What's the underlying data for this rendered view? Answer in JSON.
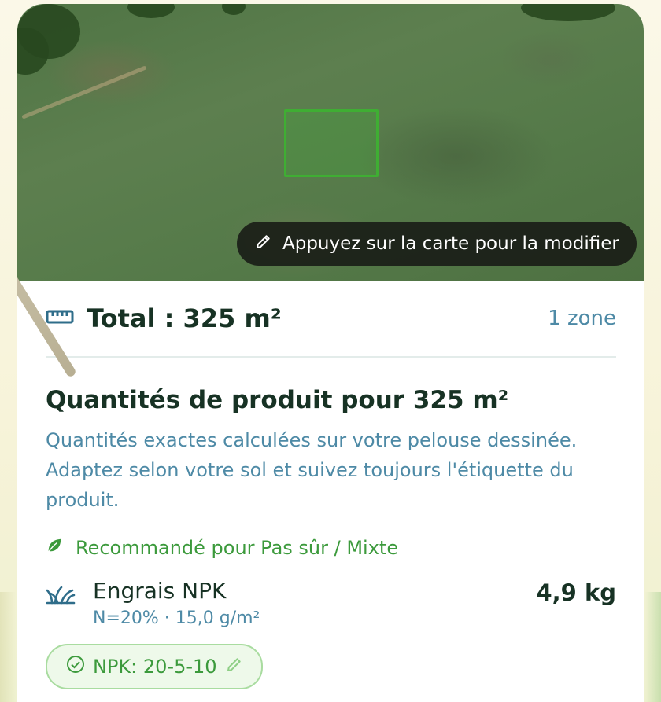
{
  "map": {
    "hint_label": "Appuyez sur la carte pour la modifier",
    "hint_icon": "pencil-icon"
  },
  "summary": {
    "total_label": "Total : 325 m²",
    "total_icon": "ruler-icon",
    "zone_count": "1 zone"
  },
  "quantities": {
    "title": "Quantités de produit pour 325 m²",
    "description": "Quantités exactes calculées sur votre pelouse dessinée. Adaptez selon votre sol et suivez toujours l'étiquette du produit.",
    "recommendation": "Recommandé pour Pas sûr / Mixte",
    "recommendation_icon": "leaf-icon"
  },
  "product": {
    "name": "Engrais NPK",
    "detail": "N=20% · 15,0 g/m²",
    "quantity": "4,9 kg",
    "icon": "grass-icon",
    "npk_chip": "NPK: 20-5-10"
  },
  "colors": {
    "primary_text": "#173224",
    "secondary_text": "#4e8aa6",
    "accent_green": "#3c9a3c",
    "zone_outline": "#3fae33"
  }
}
